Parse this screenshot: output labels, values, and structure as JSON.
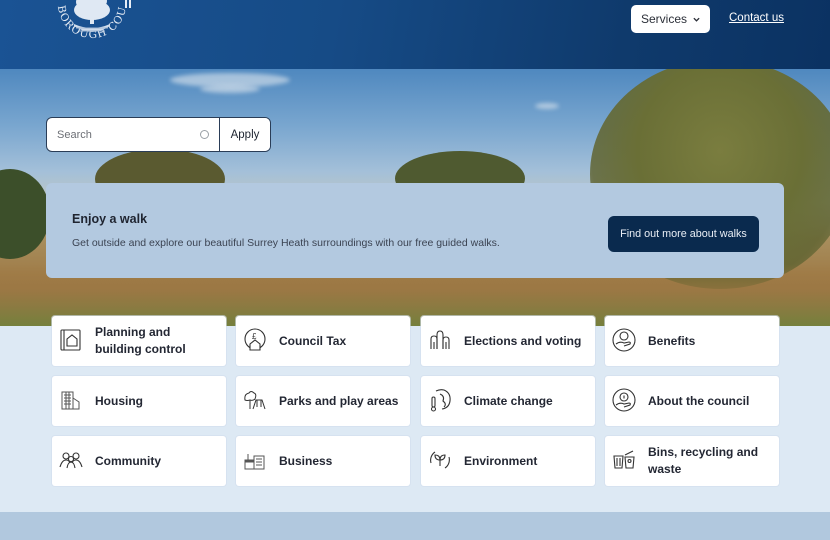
{
  "header": {
    "logo_text": "BOROUGH COUNCIL",
    "services_label": "Services",
    "contact_label": "Contact us",
    "brand_color": "#164b86"
  },
  "search": {
    "placeholder": "Search",
    "value": "",
    "apply_label": "Apply"
  },
  "promo": {
    "title": "Enjoy a walk",
    "text": "Get outside and explore our beautiful Surrey Heath surroundings with our free guided walks.",
    "button_label": "Find out more about walks",
    "button_color": "#0a2a4e",
    "background_color": "#b3c9e0"
  },
  "tiles": [
    {
      "label": "Planning and building control",
      "icon": "planning-icon"
    },
    {
      "label": "Council Tax",
      "icon": "council-tax-icon"
    },
    {
      "label": "Elections and voting",
      "icon": "elections-icon"
    },
    {
      "label": "Benefits",
      "icon": "benefits-icon"
    },
    {
      "label": "Housing",
      "icon": "housing-icon"
    },
    {
      "label": "Parks and play areas",
      "icon": "parks-icon"
    },
    {
      "label": "Climate change",
      "icon": "climate-icon"
    },
    {
      "label": "About the council",
      "icon": "about-icon"
    },
    {
      "label": "Community",
      "icon": "community-icon"
    },
    {
      "label": "Business",
      "icon": "business-icon"
    },
    {
      "label": "Environment",
      "icon": "environment-icon"
    },
    {
      "label": "Bins, recycling and waste",
      "icon": "bins-icon"
    }
  ]
}
